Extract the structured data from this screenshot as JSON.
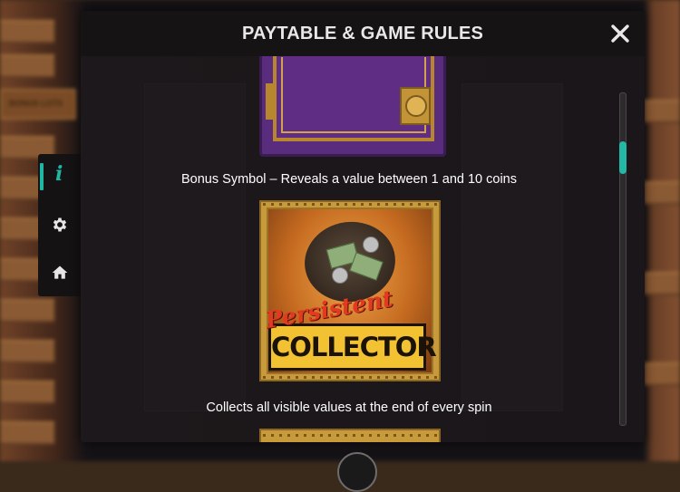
{
  "modal": {
    "title": "PAYTABLE & GAME RULES",
    "close_icon": "close-icon"
  },
  "background": {
    "sign_text": "BONUS LOTS"
  },
  "symbols": [
    {
      "name": "bonus-symbol",
      "caption": "Bonus Symbol – Reveals a value between 1 and 10 coins"
    },
    {
      "name": "persistent-collector-symbol",
      "banner_top": "Persistent",
      "banner_bottom": "COLLECTOR",
      "caption": "Collects all visible values at the end of every spin"
    }
  ],
  "side_menu": {
    "items": [
      {
        "icon": "info-icon",
        "label": "i",
        "active": true
      },
      {
        "icon": "gear-icon",
        "active": false
      },
      {
        "icon": "home-icon",
        "active": false
      }
    ]
  },
  "colors": {
    "accent": "#1fb7a3",
    "modal_bg": "#161314",
    "title_text": "#e8e8e8"
  }
}
